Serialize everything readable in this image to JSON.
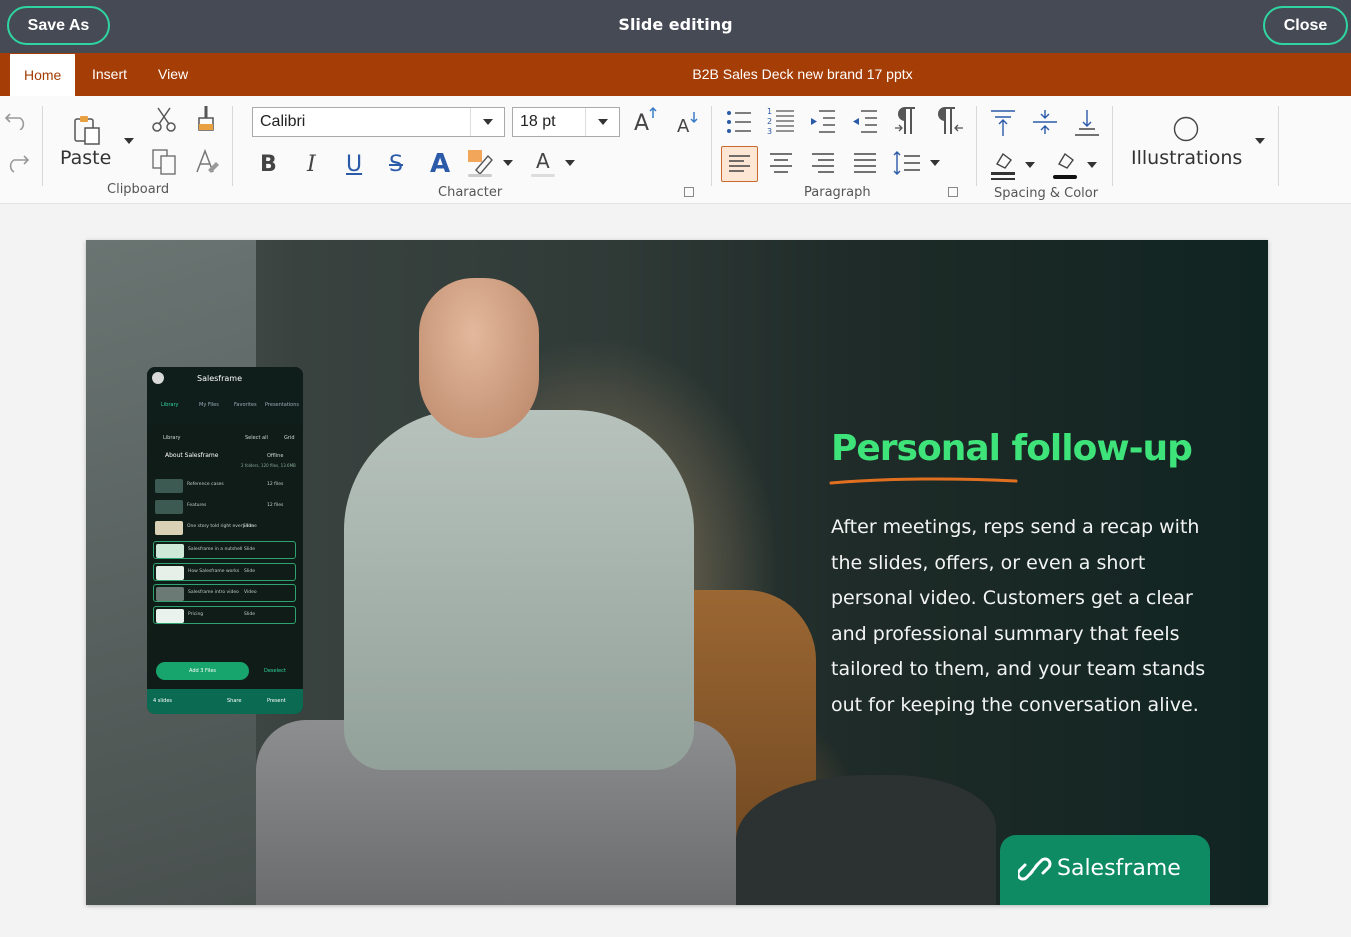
{
  "titlebar": {
    "title": "Slide editing",
    "save_as_label": "Save As",
    "close_label": "Close"
  },
  "ribbon_tabs": {
    "home": "Home",
    "insert": "Insert",
    "view": "View",
    "document_name": "B2B Sales Deck new brand 17 pptx"
  },
  "clipboard": {
    "paste_label": "Paste",
    "group_label": "Clipboard"
  },
  "character": {
    "font_name": "Calibri",
    "font_size": "18 pt",
    "bold": "B",
    "italic": "I",
    "underline": "U",
    "strikethrough": "S",
    "text_effect": "A",
    "font_color": "A",
    "group_label": "Character"
  },
  "paragraph": {
    "group_label": "Paragraph",
    "active_alignment": "align-left"
  },
  "spacing": {
    "group_label": "Spacing & Color"
  },
  "illustrations": {
    "label": "Illustrations"
  },
  "slide": {
    "headline_part1": "Personal",
    "headline_part2": "follow-up",
    "body": "After meetings, reps send a recap with the slides, offers, or even a short personal video. Customers get a clear and professional summary that feels tailored to them, and your team stands out for keeping the conversation alive.",
    "brand_name": "Salesframe",
    "headline_color": "#3ee37a",
    "underline_color": "#e07020",
    "brand_color": "#0e8b63",
    "phone": {
      "app_name": "Salesframe",
      "nav": [
        "Library",
        "My Files",
        "Favorites",
        "Presentations"
      ],
      "breadcrumb": "Library",
      "select_all": "Select all",
      "grid": "Grid",
      "folder_title": "About Salesframe",
      "offline": "Offline",
      "folder_meta": "2 folders, 120 files, 13.6MB",
      "rows": [
        {
          "label": "Reference cases",
          "meta": "12 files"
        },
        {
          "label": "Features",
          "meta": "12 files"
        },
        {
          "label": "One story told right every time",
          "meta": "Slide"
        },
        {
          "label": "Salesframe in a nutshell",
          "meta": "Slide"
        },
        {
          "label": "How Salesframe works",
          "meta": "Slide"
        },
        {
          "label": "Salesframe intro video",
          "meta": "Video"
        },
        {
          "label": "Pricing",
          "meta": "Slide"
        }
      ],
      "add_files": "Add 3 Files",
      "deselect": "Deselect",
      "slides_count": "4 slides",
      "share": "Share",
      "present": "Present"
    }
  },
  "colors": {
    "titlebar_bg": "#454a55",
    "tabbar_bg": "#a43e06",
    "accent_outline": "#2fd5a1"
  }
}
